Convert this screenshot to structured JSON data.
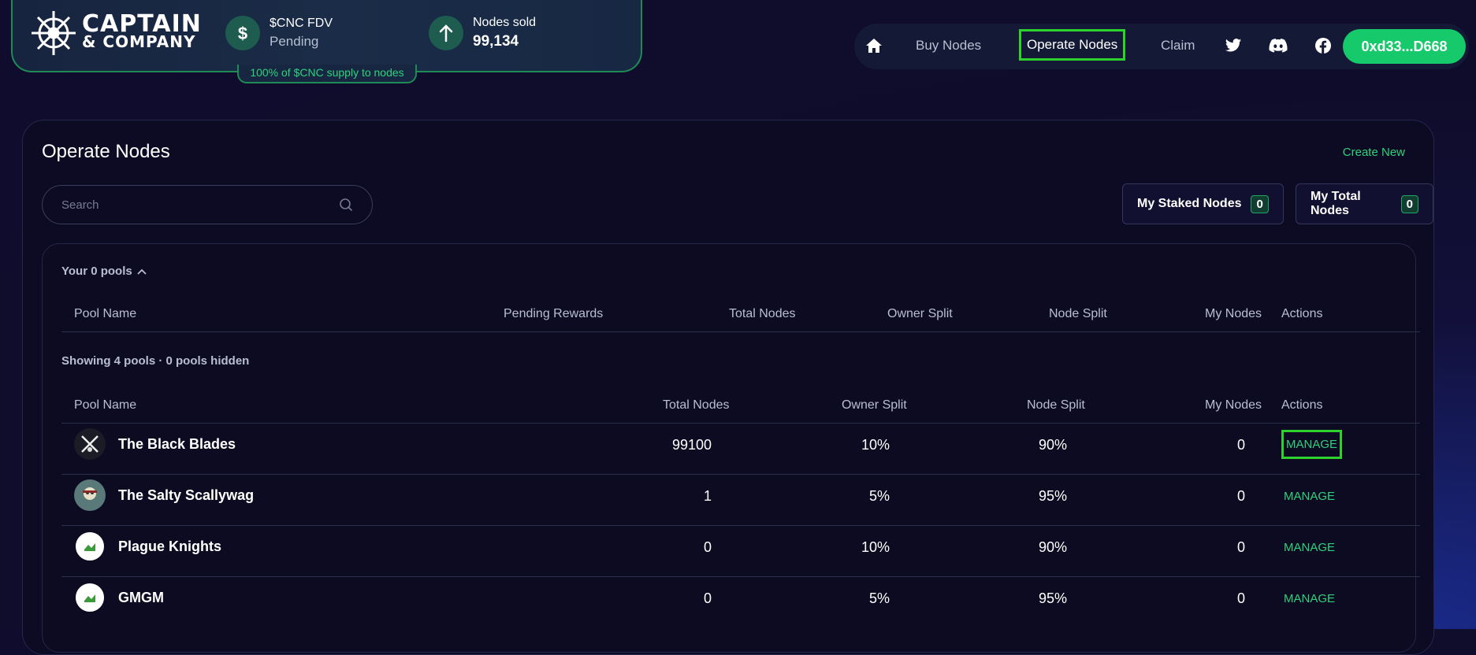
{
  "brand": {
    "line1": "CAPTAIN",
    "line2": "& COMPANY"
  },
  "stats": [
    {
      "label": "$CNC FDV",
      "value": "Pending",
      "icon": "dollar-icon"
    },
    {
      "label": "Nodes sold",
      "value": "99,134",
      "icon": "arrow-up-icon"
    }
  ],
  "banner_note": "100% of $CNC supply to nodes",
  "nav": {
    "items": [
      "Buy Nodes",
      "Operate Nodes",
      "Claim"
    ],
    "active": "Operate Nodes",
    "wallet": "0xd33...D668"
  },
  "page": {
    "title": "Operate Nodes",
    "create_new": "Create New",
    "search_placeholder": "Search",
    "my_staked_label": "My Staked Nodes",
    "my_staked_count": "0",
    "my_total_label": "My Total Nodes",
    "my_total_count": "0"
  },
  "your_pools": {
    "toggle": "Your 0 pools",
    "headers": [
      "Pool Name",
      "Pending Rewards",
      "Total Nodes",
      "Owner Split",
      "Node Split",
      "My Nodes",
      "Actions"
    ]
  },
  "all_pools": {
    "summary": "Showing 4 pools · 0 pools hidden",
    "headers": [
      "Pool Name",
      "Total Nodes",
      "Owner Split",
      "Node Split",
      "My Nodes",
      "Actions"
    ],
    "rows": [
      {
        "name": "The Black Blades",
        "total": "99100",
        "owner": "10%",
        "node": "90%",
        "mine": "0",
        "action": "MANAGE"
      },
      {
        "name": "The Salty Scallywag",
        "total": "1",
        "owner": "5%",
        "node": "95%",
        "mine": "0",
        "action": "MANAGE"
      },
      {
        "name": "Plague Knights",
        "total": "0",
        "owner": "10%",
        "node": "90%",
        "mine": "0",
        "action": "MANAGE"
      },
      {
        "name": "GMGM",
        "total": "0",
        "owner": "5%",
        "node": "95%",
        "mine": "0",
        "action": "MANAGE"
      }
    ]
  },
  "colors": {
    "accent": "#2ed17c",
    "wallet": "#16c96b",
    "highlight": "#2ed12e"
  }
}
